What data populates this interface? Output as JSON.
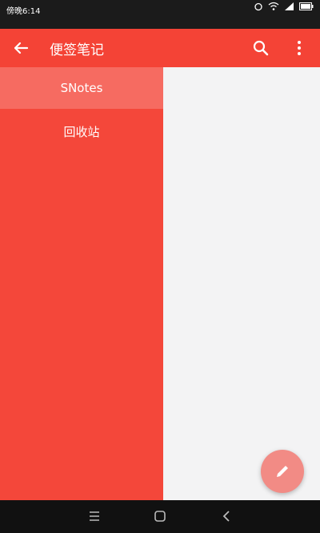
{
  "status_bar": {
    "time": "傍晚6:14",
    "icons": [
      "wifi-icon",
      "signal-icon",
      "battery-icon"
    ]
  },
  "app_bar": {
    "title": "便签笔记",
    "icons": [
      "back-arrow-icon",
      "search-icon",
      "more-vert-icon"
    ]
  },
  "drawer": {
    "items": [
      {
        "label": "SNotes",
        "selected": true
      },
      {
        "label": "回收站",
        "selected": false
      }
    ]
  },
  "fab": {
    "icon": "pencil-icon"
  },
  "nav_bar": {
    "icons": [
      "menu-icon",
      "home-icon",
      "back-icon"
    ]
  },
  "colors": {
    "primary": "#f44336",
    "drawer": "#f4473a",
    "content_bg": "#f3f3f4",
    "fab": "#f28b85"
  }
}
